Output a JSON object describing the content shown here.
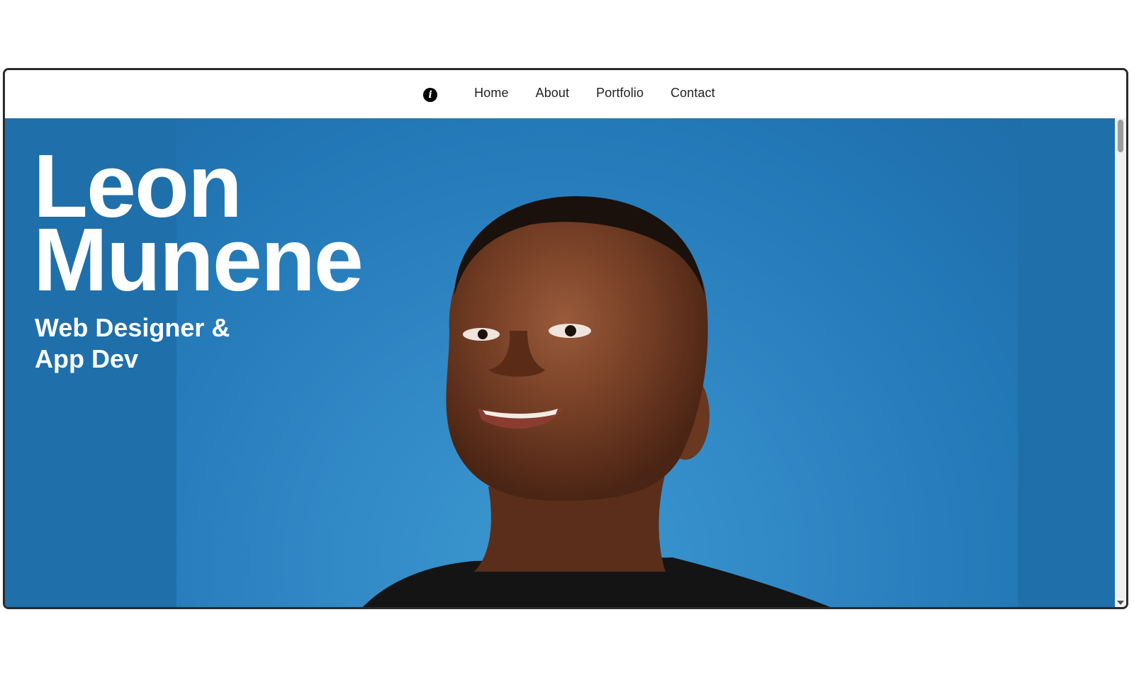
{
  "nav": {
    "logo_glyph": "i",
    "links": [
      "Home",
      "About",
      "Portfolio",
      "Contact"
    ]
  },
  "hero": {
    "name_line1": "Leon",
    "name_line2": "Munene",
    "role_line1": "Web Designer &",
    "role_line2": "App Dev"
  },
  "colors": {
    "hero_background": "#1f6fab",
    "photo_background": "#2f86c3",
    "text": "#ffffff",
    "nav_text": "#222222"
  },
  "icons": {
    "logo": "logo-icon",
    "scroll_down": "scroll-down-arrow-icon"
  }
}
